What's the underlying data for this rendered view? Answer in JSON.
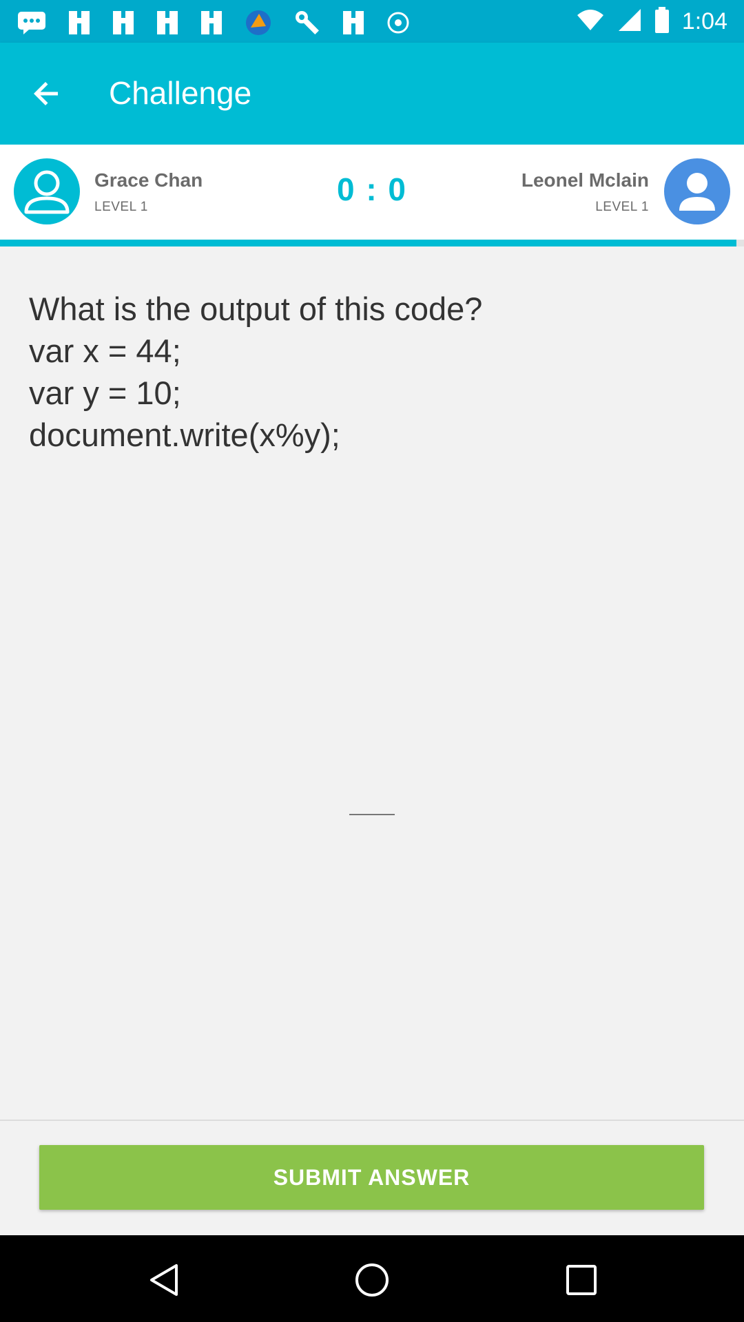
{
  "status_bar": {
    "time": "1:04",
    "icons": [
      "messages-icon",
      "bookmark-icon",
      "bookmark-icon",
      "bookmark-icon",
      "bookmark-icon",
      "app-icon",
      "wrench-icon",
      "bookmark-icon",
      "sync-icon",
      "wifi-icon",
      "signal-icon",
      "battery-icon"
    ]
  },
  "app_bar": {
    "title": "Challenge",
    "back_icon": "arrow-back-icon"
  },
  "players": {
    "left": {
      "name": "Grace Chan",
      "level": "LEVEL 1",
      "avatar_icon": "person-outline-icon"
    },
    "right": {
      "name": "Leonel Mclain",
      "level": "LEVEL 1",
      "avatar_icon": "person-icon"
    },
    "score": "0 : 0"
  },
  "timer_progress_percent": 99,
  "question": {
    "lines": [
      "What is the output of this code?",
      "var x = 44;",
      "var y = 10;",
      "document.write(x%y);"
    ],
    "answer_value": ""
  },
  "submit_label": "SUBMIT ANSWER",
  "colors": {
    "primary": "#00bcd4",
    "status_bar": "#00aacb",
    "submit": "#8bc34a",
    "right_avatar": "#4a90e2"
  },
  "nav_bar": {
    "icons": [
      "back-triangle-icon",
      "home-circle-icon",
      "recents-square-icon"
    ]
  }
}
